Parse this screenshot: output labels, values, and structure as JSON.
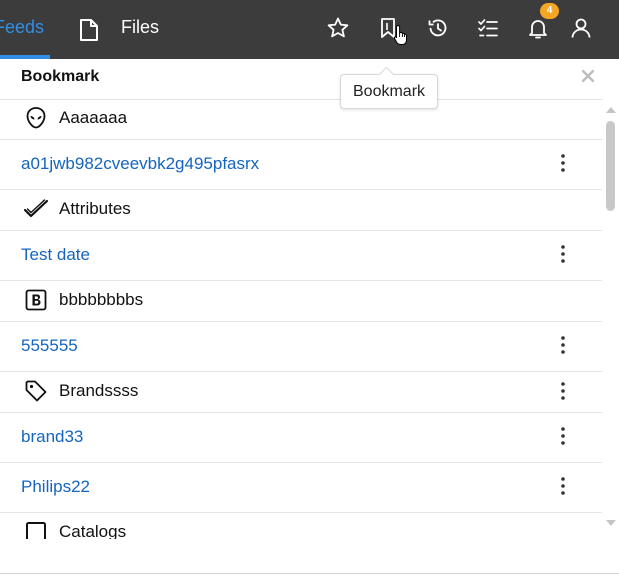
{
  "topbar": {
    "tabs": {
      "feeds_label": "Feeds",
      "files_label": "Files"
    },
    "notifications_count": "4",
    "icons": [
      "star-icon",
      "bookmark-icon",
      "history-icon",
      "checklist-icon",
      "bell-icon",
      "user-icon"
    ]
  },
  "colors": {
    "topbar_bg": "#3c3c3c",
    "accent": "#2f8fe6",
    "link": "#1565c0",
    "badge": "#f5a623"
  },
  "tooltip": {
    "text": "Bookmark"
  },
  "panel": {
    "title": "Bookmark",
    "groups": [
      {
        "label": "Aaaaaaa",
        "icon": "alien-icon",
        "items": [
          {
            "label": "a01jwb982cveevbk2g495pfasrx"
          }
        ]
      },
      {
        "label": "Attributes",
        "icon": "check-icon",
        "items": [
          {
            "label": "Test date"
          }
        ]
      },
      {
        "label": "bbbbbbbbs",
        "icon": "bold-b-icon",
        "items": [
          {
            "label": "555555"
          }
        ]
      },
      {
        "label": "Brandssss",
        "icon": "tag-icon",
        "items": [
          {
            "label": "brand33"
          },
          {
            "label": "Philips22"
          }
        ]
      },
      {
        "label": "Catalogs",
        "icon": "square-icon",
        "items": []
      }
    ]
  }
}
